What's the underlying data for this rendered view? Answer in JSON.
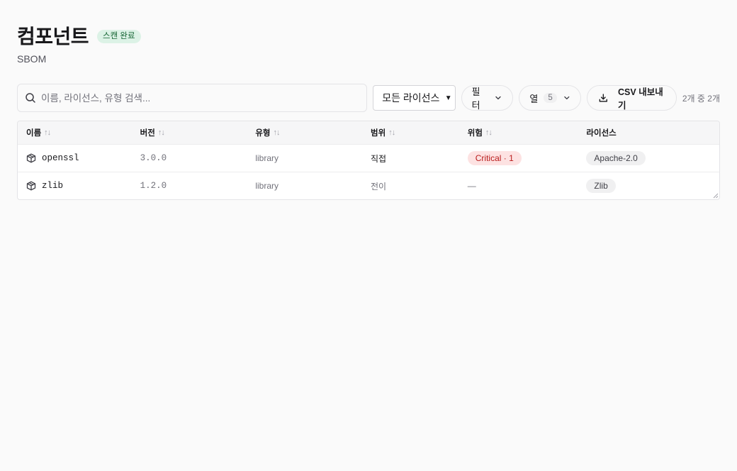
{
  "header": {
    "title": "컴포넌트",
    "badge": "스캔 완료",
    "subtitle": "SBOM"
  },
  "toolbar": {
    "search_placeholder": "이름, 라이선스, 유형 검색...",
    "search_value": "",
    "license_select": "모든 라이선스",
    "filter_label": "필터",
    "columns_label": "열",
    "columns_count": "5",
    "export_label": "CSV 내보내기",
    "result_count": "2개 중 2개"
  },
  "table": {
    "columns": [
      "이름",
      "버전",
      "유형",
      "범위",
      "위험",
      "라이선스"
    ],
    "sort_glyph": "↑↓",
    "rows": [
      {
        "name": "openssl",
        "version": "3.0.0",
        "type": "library",
        "scope": "직접",
        "risk": "Critical · 1",
        "license": "Apache-2.0"
      },
      {
        "name": "zlib",
        "version": "1.2.0",
        "type": "library",
        "scope": "전이",
        "risk": "—",
        "license": "Zlib"
      }
    ]
  },
  "colors": {
    "background": "#fafafa",
    "success_badge_bg": "#dcf2e6",
    "success_badge_fg": "#166534",
    "critical_bg": "#fde2e2",
    "critical_fg": "#b91c1c"
  },
  "icons": {
    "search": "search-icon",
    "chevron": "chevron-down-icon",
    "download": "download-icon",
    "package": "package-icon"
  }
}
